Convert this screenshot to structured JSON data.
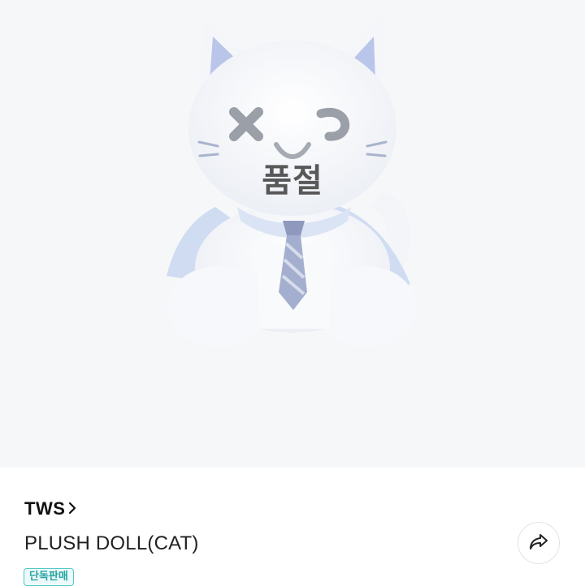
{
  "product": {
    "image_alt": "TWS plush doll cat",
    "soldout_label": "품절",
    "brand": "TWS",
    "name": "PLUSH DOLL(CAT)",
    "badge": "단독판매"
  },
  "icons": {
    "brand_chevron": "chevron-right-icon",
    "share": "share-arrow-icon"
  },
  "colors": {
    "hero_bg": "#f6f7f8",
    "badge_border": "#54c7c7",
    "badge_text": "#25a3a3",
    "soldout_text": "#585858"
  }
}
